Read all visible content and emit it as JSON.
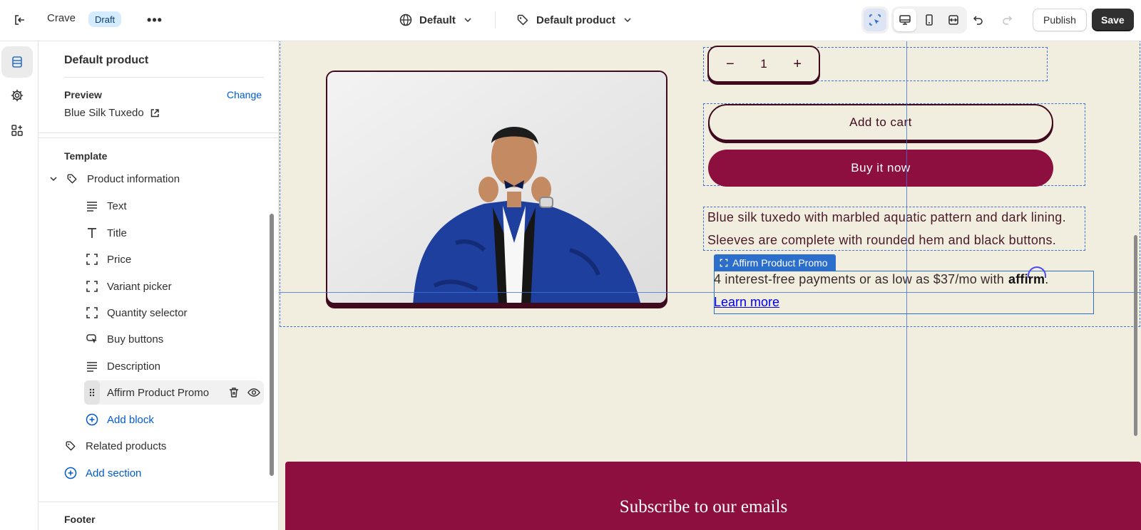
{
  "topbar": {
    "app_name": "Crave",
    "status_badge": "Draft",
    "theme_label": "Default",
    "template_label": "Default product",
    "publish_label": "Publish",
    "save_label": "Save"
  },
  "sidebar": {
    "title": "Default product",
    "preview_label": "Preview",
    "change_label": "Change",
    "preview_value": "Blue Silk Tuxedo",
    "template_heading": "Template",
    "section_name": "Product information",
    "blocks": [
      "Text",
      "Title",
      "Price",
      "Variant picker",
      "Quantity selector",
      "Buy buttons",
      "Description",
      "Affirm Product Promo"
    ],
    "add_block_label": "Add block",
    "related_products_label": "Related products",
    "add_section_label": "Add section",
    "footer_heading": "Footer"
  },
  "canvas": {
    "quantity_value": "1",
    "add_to_cart_label": "Add to cart",
    "buy_now_label": "Buy it now",
    "description_line1": "Blue silk tuxedo with marbled aquatic pattern and dark lining.",
    "description_line2": "Sleeves are complete with rounded hem and black buttons.",
    "promo_tag_label": "Affirm Product Promo",
    "promo_text": "4 interest-free payments or as low as $37/mo with",
    "affirm_brand": "affirm",
    "promo_period": ".",
    "learn_more_label": "Learn more",
    "subscribe_title": "Subscribe to our emails"
  },
  "colors": {
    "canvas_bg": "#f1eee0",
    "brand_burgundy": "#8c0f3f",
    "outline_dark": "#3f0a1e",
    "selection_blue": "#2c6ecb",
    "link_blue": "#005bd3"
  },
  "icons": [
    "exit-icon",
    "more-icon",
    "globe-icon",
    "chevron-down-icon",
    "tag-icon",
    "inspect-icon",
    "desktop-icon",
    "mobile-icon",
    "fullwidth-icon",
    "undo-icon",
    "redo-icon",
    "sections-icon",
    "gear-icon",
    "apps-icon",
    "external-link-icon",
    "text-lines-icon",
    "title-icon",
    "block-icon",
    "cursor-icon",
    "drag-handle-icon",
    "delete-icon",
    "eye-icon",
    "add-circle-icon"
  ]
}
